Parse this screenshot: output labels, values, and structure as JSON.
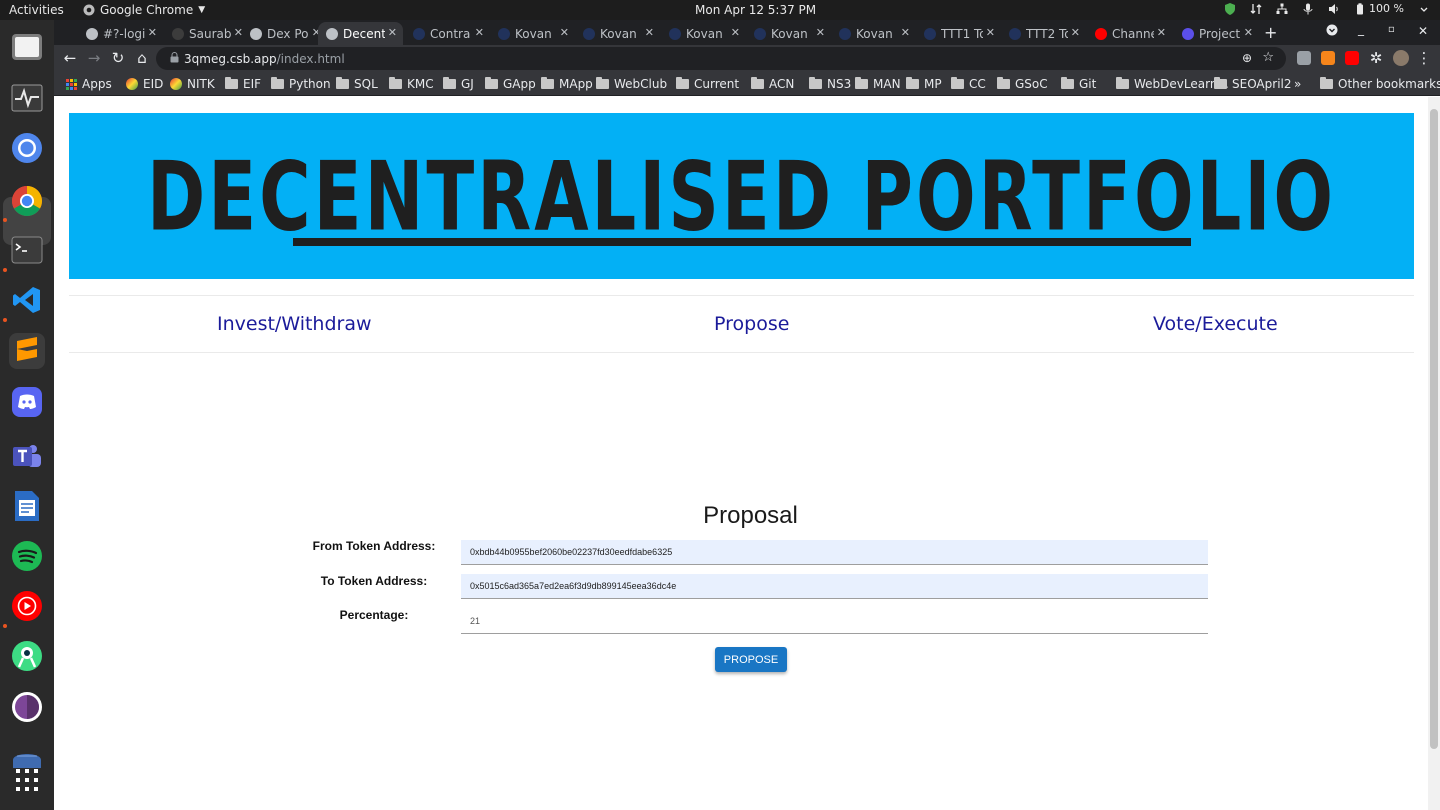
{
  "os": {
    "activities": "Activities",
    "app_name": "Google Chrome",
    "clock": "Mon Apr 12   5:37 PM",
    "battery": "100 %"
  },
  "tabs": [
    {
      "title": "#?-logi",
      "icon": "page-icon",
      "color": "#bdc1c6"
    },
    {
      "title": "Saurab",
      "icon": "page-icon",
      "color": "#3c3c3c"
    },
    {
      "title": "Dex Po",
      "icon": "codesandbox-icon",
      "color": "#bdc1c6"
    },
    {
      "title": "Decent",
      "icon": "codesandbox-icon",
      "color": "#bdc1c6"
    },
    {
      "title": "Contra",
      "icon": "etherscan-icon",
      "color": "#21325b"
    },
    {
      "title": "Kovan",
      "icon": "etherscan-icon",
      "color": "#21325b"
    },
    {
      "title": "Kovan",
      "icon": "etherscan-icon",
      "color": "#21325b"
    },
    {
      "title": "Kovan",
      "icon": "etherscan-icon",
      "color": "#21325b"
    },
    {
      "title": "Kovan",
      "icon": "etherscan-icon",
      "color": "#21325b"
    },
    {
      "title": "Kovan",
      "icon": "etherscan-icon",
      "color": "#21325b"
    },
    {
      "title": "TTT1 To",
      "icon": "etherscan-icon",
      "color": "#21325b"
    },
    {
      "title": "TTT2 To",
      "icon": "etherscan-icon",
      "color": "#21325b"
    },
    {
      "title": "Channe",
      "icon": "youtube-icon",
      "color": "#ff0000"
    },
    {
      "title": "Project",
      "icon": "project-icon",
      "color": "#5b4fe9"
    }
  ],
  "active_tab_index": 3,
  "address": {
    "host": "3qmeg.csb.app",
    "path": "/index.html"
  },
  "bookmarks": [
    {
      "label": "Apps",
      "type": "apps"
    },
    {
      "label": "EID",
      "type": "site"
    },
    {
      "label": "NITK",
      "type": "site"
    },
    {
      "label": "EIF",
      "type": "folder"
    },
    {
      "label": "Python",
      "type": "folder"
    },
    {
      "label": "SQL",
      "type": "folder"
    },
    {
      "label": "KMC",
      "type": "folder"
    },
    {
      "label": "GJ",
      "type": "folder"
    },
    {
      "label": "GApp",
      "type": "folder"
    },
    {
      "label": "MApp",
      "type": "folder"
    },
    {
      "label": "WebClub",
      "type": "folder"
    },
    {
      "label": "Current",
      "type": "folder"
    },
    {
      "label": "ACN",
      "type": "folder"
    },
    {
      "label": "NS3",
      "type": "folder"
    },
    {
      "label": "MAN",
      "type": "folder"
    },
    {
      "label": "MP",
      "type": "folder"
    },
    {
      "label": "CC",
      "type": "folder"
    },
    {
      "label": "GSoC",
      "type": "folder"
    },
    {
      "label": "Git",
      "type": "folder"
    },
    {
      "label": "WebDevLearn...",
      "type": "folder"
    },
    {
      "label": "SEOApril2",
      "type": "folder"
    }
  ],
  "bookmarks_overflow": "»",
  "other_bookmarks": "Other bookmarks",
  "page": {
    "hero_title": "DECENTRALISED PORTFOLIO",
    "hero_color": "#03b0f5",
    "nav": {
      "invest": "Invest/Withdraw",
      "propose": "Propose",
      "vote": "Vote/Execute"
    },
    "proposal_title": "Proposal",
    "fields": {
      "from_label": "From Token Address:",
      "from_value": "0xbdb44b0955bef2060be02237fd30eedfdabe6325",
      "to_label": "To Token Address:",
      "to_value": "0x5015c6ad365a7ed2ea6f3d9db899145eea36dc4e",
      "pct_label": "Percentage:",
      "pct_value": "21"
    },
    "submit_label": "PROPOSE",
    "link_color": "#1b1b9a"
  }
}
